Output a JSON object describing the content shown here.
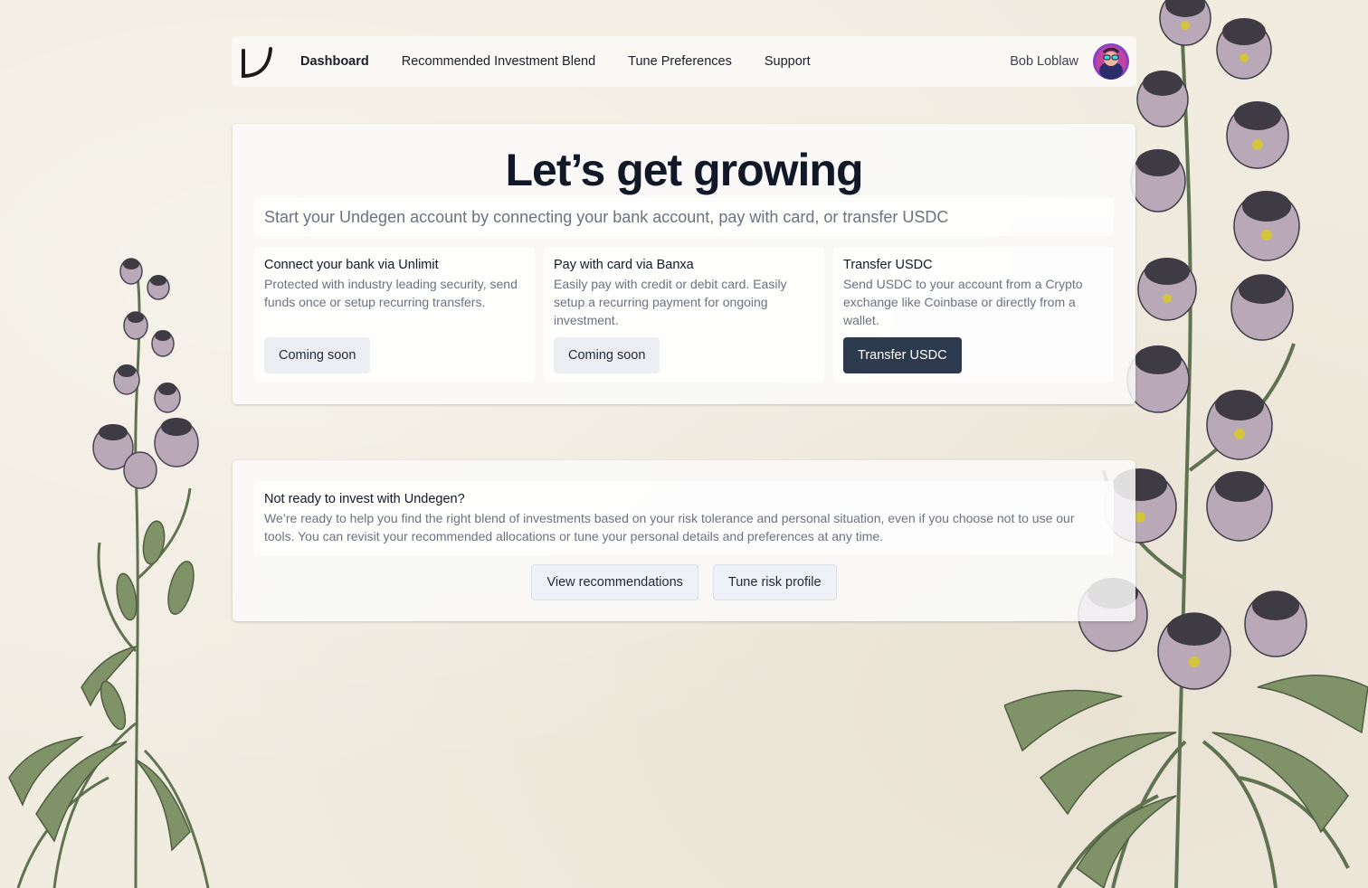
{
  "nav": {
    "logo_icon": "undegen-logo-icon",
    "links": [
      {
        "label": "Dashboard",
        "active": true
      },
      {
        "label": "Recommended Investment Blend",
        "active": false
      },
      {
        "label": "Tune Preferences",
        "active": false
      },
      {
        "label": "Support",
        "active": false
      }
    ],
    "user_name": "Bob Loblaw",
    "avatar_icon": "user-avatar"
  },
  "hero": {
    "title": "Let’s get growing",
    "subtitle": "Start your Undegen account by connecting your bank account, pay with card, or transfer USDC"
  },
  "options": [
    {
      "title": "Connect your bank via Unlimit",
      "description": "Protected with industry leading security, send funds once or setup recurring transfers.",
      "button": "Coming soon"
    },
    {
      "title": "Pay with card via Banxa",
      "description": "Easily pay with credit or debit card. Easily setup a recurring payment for ongoing investment.",
      "button": "Coming soon"
    },
    {
      "title": "Transfer USDC",
      "description": "Send USDC to your account from a Crypto exchange like Coinbase or directly from a wallet.",
      "button": "Transfer USDC"
    }
  ],
  "not_ready": {
    "title": "Not ready to invest with Undegen?",
    "description": "We’re ready to help you find the right blend of investments based on your risk tolerance and personal situation, even if you choose not to use our tools. You can revisit your recommended allocations or tune your personal details and preferences at any time.",
    "buttons": [
      "View recommendations",
      "Tune risk profile"
    ]
  },
  "colors": {
    "background": "#f1ece0",
    "primary_button": "#2d3a4d",
    "heading": "#111827",
    "muted_text": "#6b7280"
  },
  "decoration": {
    "background_art": "botanical-flower-illustration"
  }
}
